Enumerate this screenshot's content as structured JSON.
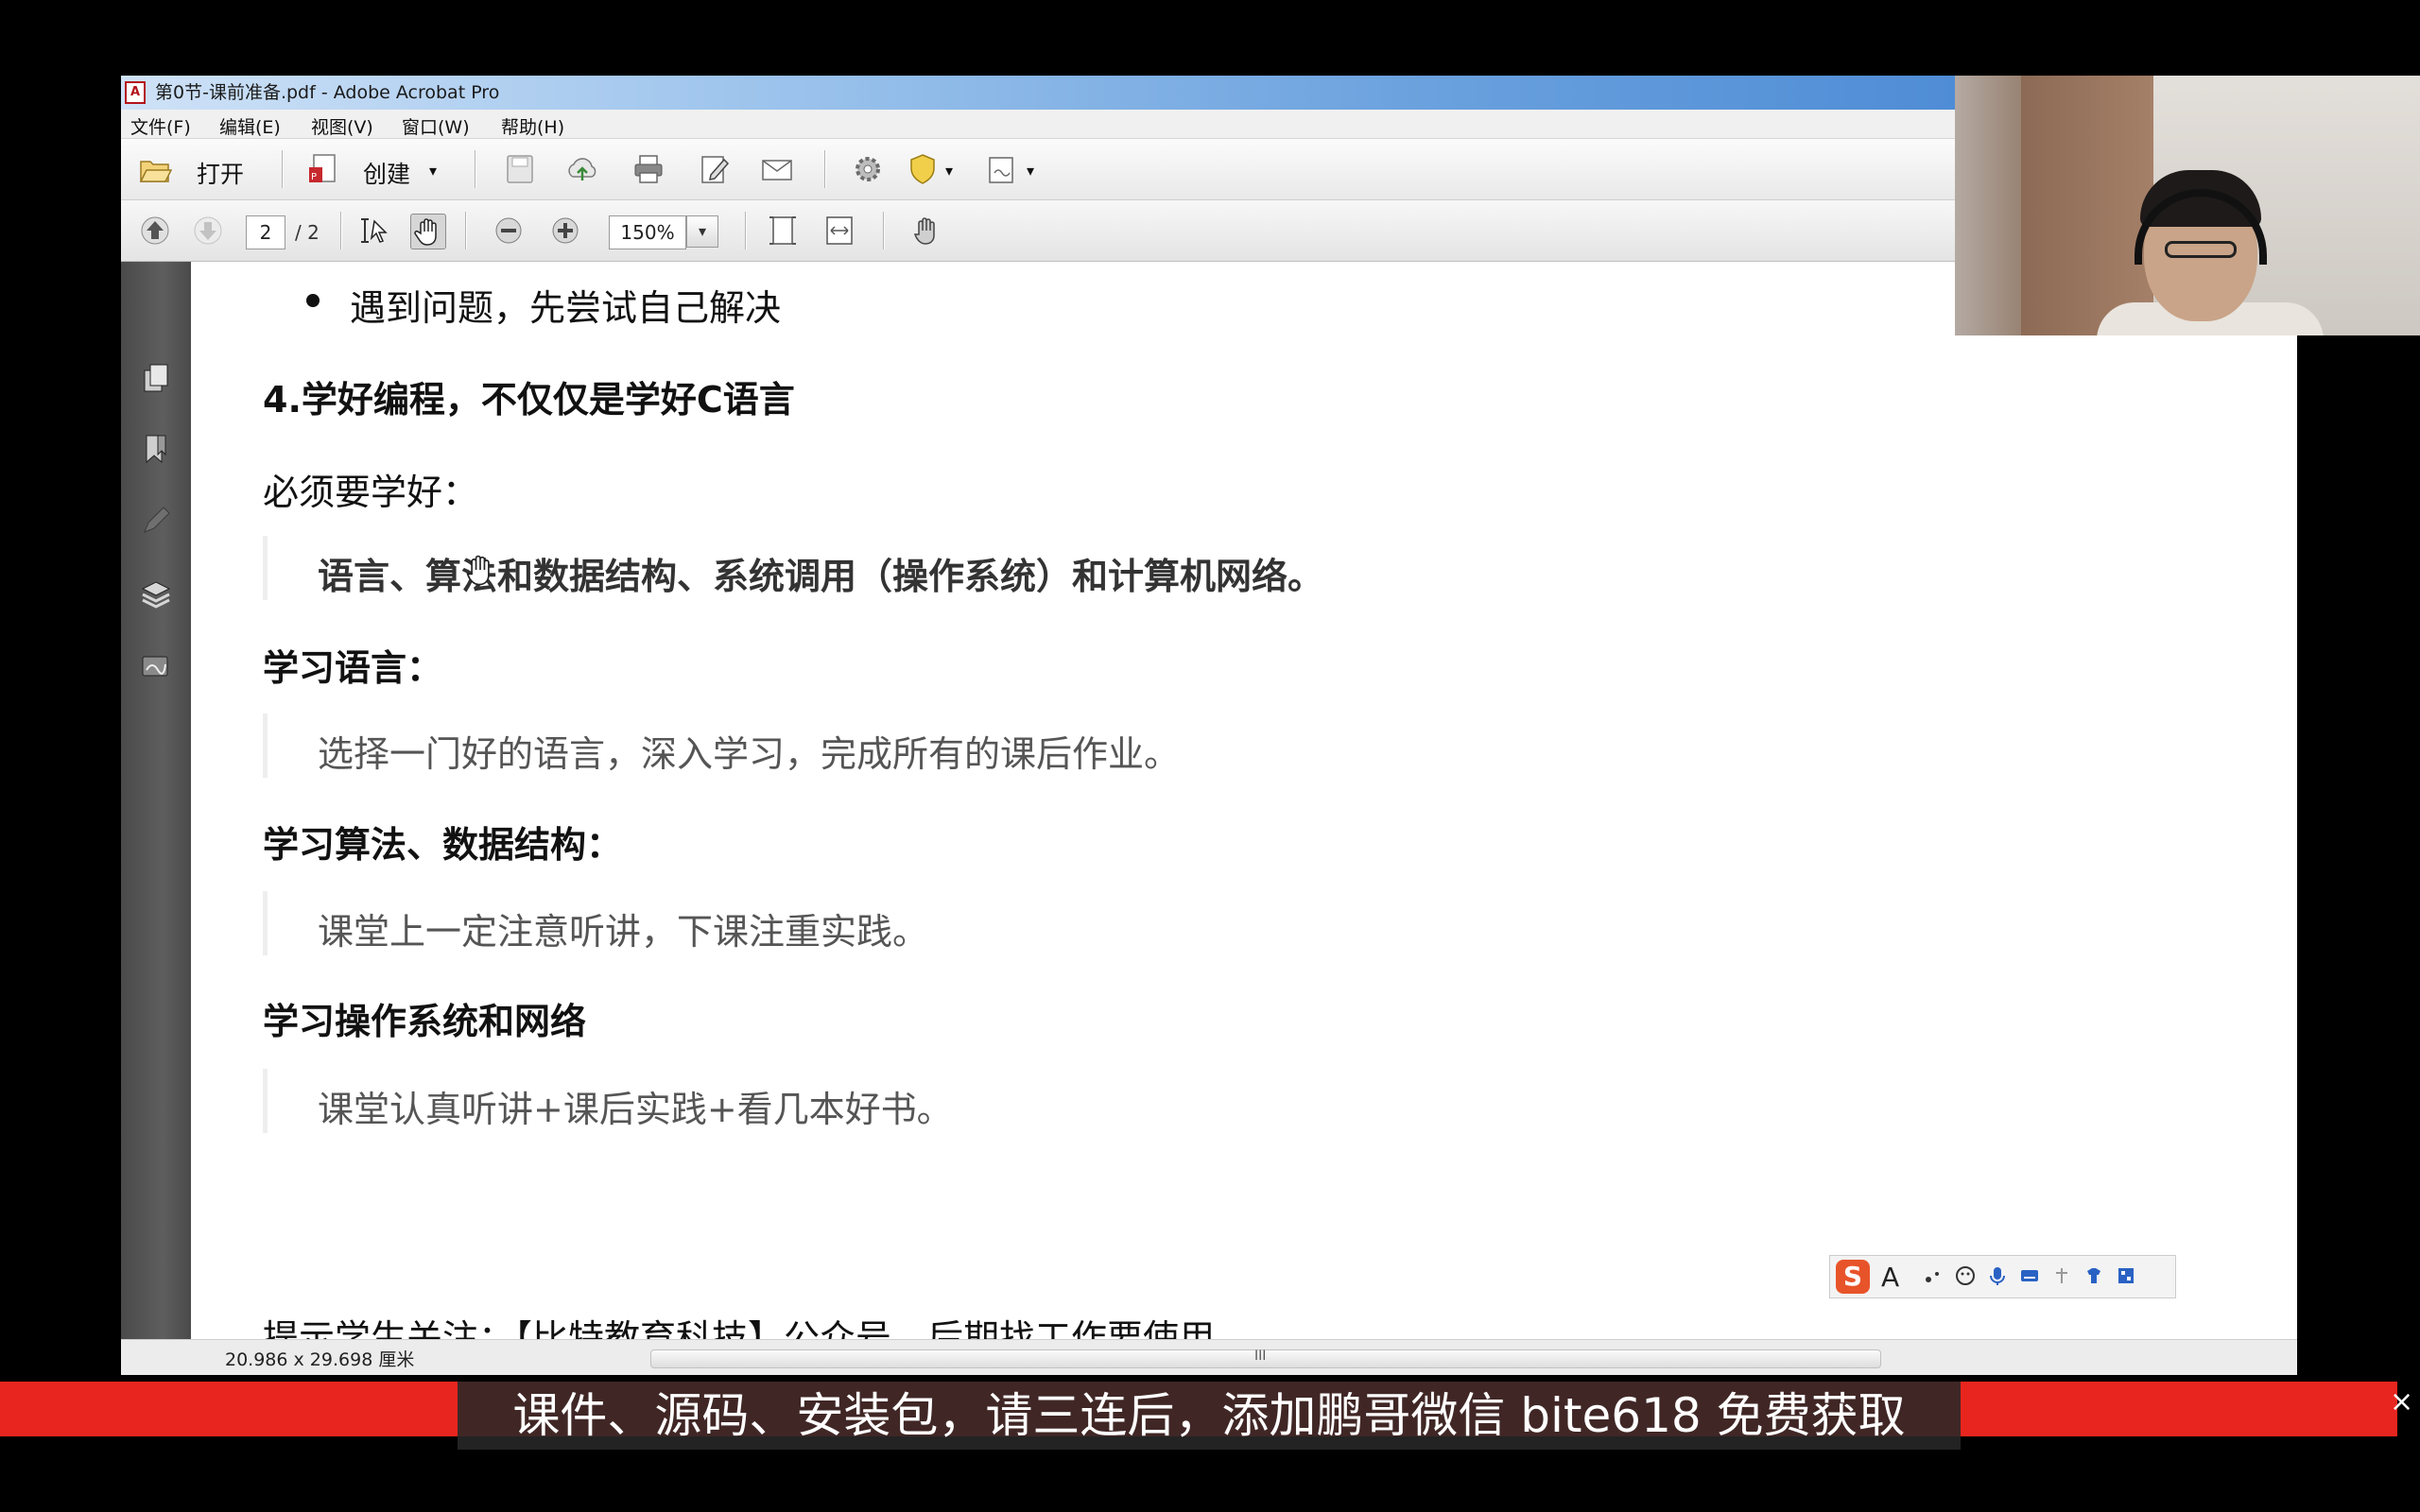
{
  "window": {
    "title": "第0节-课前准备.pdf - Adobe Acrobat Pro"
  },
  "menu": [
    "文件(F)",
    "编辑(E)",
    "视图(V)",
    "窗口(W)",
    "帮助(H)"
  ],
  "toolbar": {
    "open_label": "打开",
    "create_label": "创建",
    "page_current": "2",
    "page_total": "/ 2",
    "zoom": "150%"
  },
  "document": {
    "bullet": "遇到问题，先尝试自己解决",
    "heading4": "4.学好编程，不仅仅是学好C语言",
    "must_learn": "必须要学好：",
    "quote1": "语言、算法和数据结构、系统调用（操作系统）和计算机网络。",
    "learn_lang_heading": "学习语言：",
    "quote2": "选择一门好的语言，深入学习，完成所有的课后作业。",
    "learn_algo_heading": "学习算法、数据结构：",
    "quote3": "课堂上一定注意听讲，下课注重实践。",
    "learn_os_heading": "学习操作系统和网络",
    "quote4": "课堂认真听讲+课后实践+看几本好书。",
    "footer_hint": "提示学生关注：【比特教育科技】公众号，后期找工作要使用。"
  },
  "status": {
    "page_size": "20.986 x 29.698 厘米",
    "hscroll_grip": "III"
  },
  "ime": {
    "logo": "S",
    "mode": "A"
  },
  "caption": "课件、源码、安装包，请三连后，添加鹏哥微信 bite618 免费获取",
  "colors": {
    "banner_red": "#e8261f",
    "sidebar_gray": "#555555",
    "acrobat_red": "#b3141b"
  }
}
